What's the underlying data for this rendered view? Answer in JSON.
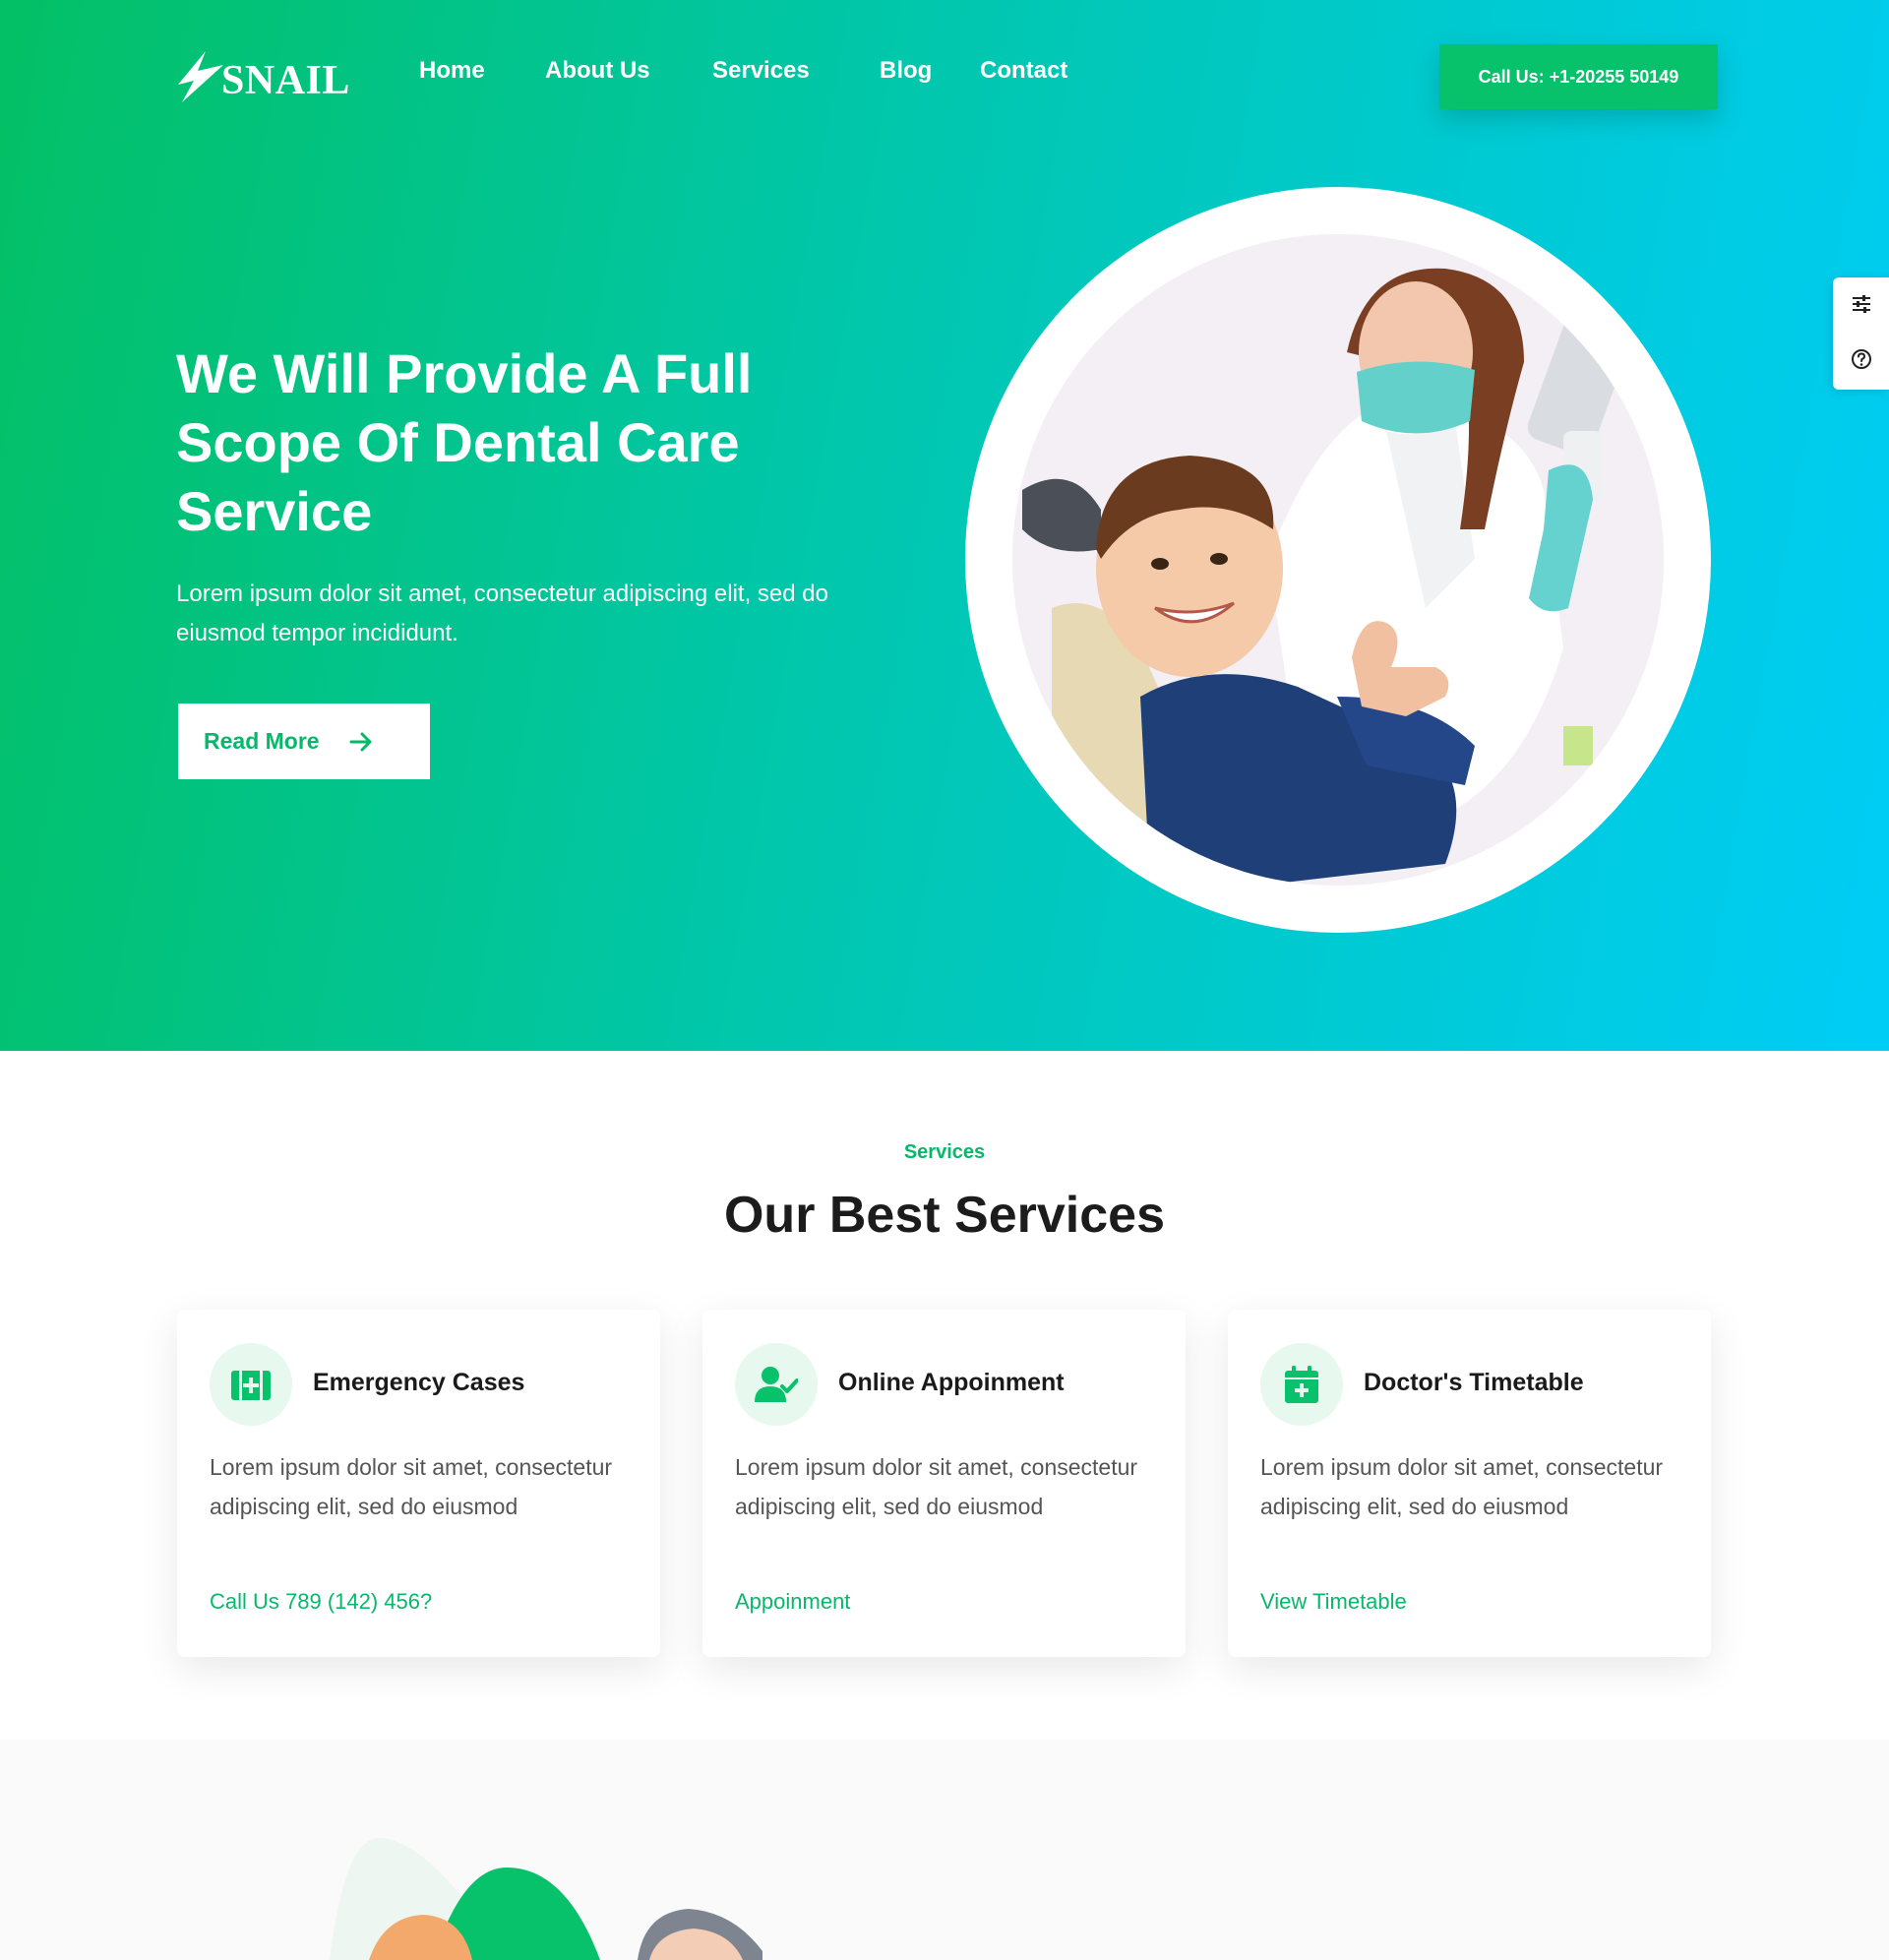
{
  "brand": {
    "name": "SNAIL",
    "primary_color": "#07c16b",
    "accent_cyan": "#00cdf7"
  },
  "nav": {
    "items": [
      {
        "label": "Home"
      },
      {
        "label": "About Us"
      },
      {
        "label": "Services"
      },
      {
        "label": "Blog"
      },
      {
        "label": "Contact"
      }
    ],
    "call_button": "Call Us: +1-20255 50149"
  },
  "hero": {
    "title_lines": [
      "We Will Provide A Full",
      "Scope Of Dental Care",
      "Service"
    ],
    "subtitle": "Lorem ipsum dolor sit amet, consectetur adipiscing elit, sed do eiusmod tempor incididunt.",
    "button": "Read More",
    "button_icon": "arrow-right-icon"
  },
  "side_tools": {
    "icons": [
      "sliders-icon",
      "help-circle-icon"
    ]
  },
  "services": {
    "tag": "Services",
    "heading": "Our Best Services",
    "cards": [
      {
        "icon": "first-aid-kit-icon",
        "title": "Emergency Cases",
        "text": "Lorem ipsum dolor sit amet, consectetur adipiscing elit, sed do eiusmod",
        "link": "Call Us 789 (142) 456?"
      },
      {
        "icon": "user-check-icon",
        "title": "Online Appoinment",
        "text": "Lorem ipsum dolor sit amet, consectetur adipiscing elit, sed do eiusmod",
        "link": "Appoinment"
      },
      {
        "icon": "calendar-plus-icon",
        "title": "Doctor's Timetable",
        "text": "Lorem ipsum dolor sit amet, consectetur adipiscing elit, sed do eiusmod",
        "link": "View Timetable"
      }
    ]
  }
}
